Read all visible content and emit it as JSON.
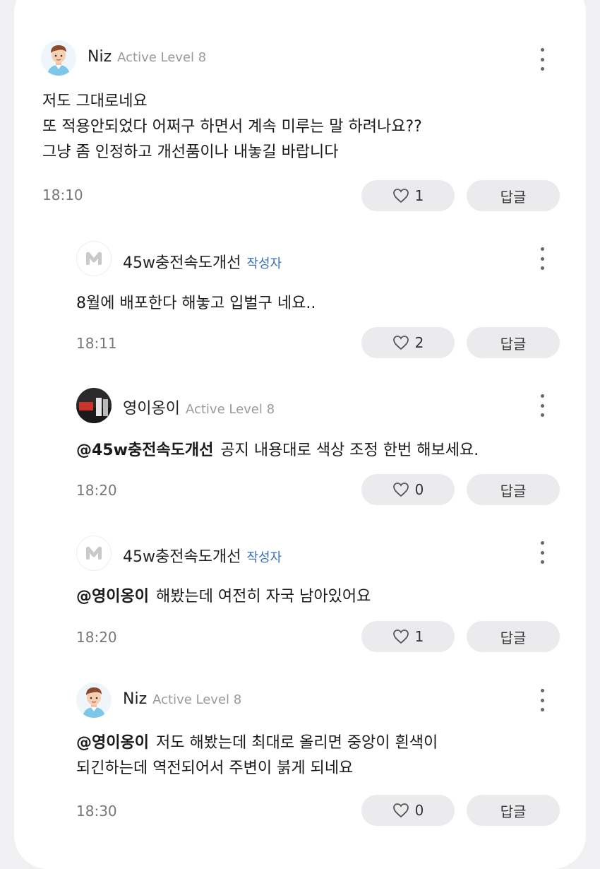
{
  "comments": [
    {
      "username": "Niz",
      "level": "Active Level 8",
      "author_tag": "",
      "mention": "",
      "lines": [
        "저도 그대로네요",
        "또 적용안되었다 어쩌구 하면서 계속 미루는 말 하려나요??",
        "그냥 좀 인정하고 개선품이나 내놓길 바랍니다"
      ],
      "time": "18:10",
      "likes": "1",
      "reply_label": "답글"
    },
    {
      "username": "45w충전속도개선",
      "level": "",
      "author_tag": "작성자",
      "mention": "",
      "lines": [
        "8월에 배포한다 해놓고 입벌구 네요.."
      ],
      "time": "18:11",
      "likes": "2",
      "reply_label": "답글"
    },
    {
      "username": "영이옹이",
      "level": "Active Level 8",
      "author_tag": "",
      "mention": "@45w충전속도개선",
      "lines": [
        "공지 내용대로 색상 조정 한번 해보세요."
      ],
      "time": "18:20",
      "likes": "0",
      "reply_label": "답글"
    },
    {
      "username": "45w충전속도개선",
      "level": "",
      "author_tag": "작성자",
      "mention": "@영이옹이",
      "lines": [
        "해봤는데 여전히 자국 남아있어요"
      ],
      "time": "18:20",
      "likes": "1",
      "reply_label": "답글"
    },
    {
      "username": "Niz",
      "level": "Active Level 8",
      "author_tag": "",
      "mention": "@영이옹이",
      "lines": [
        "저도 해봤는데 최대로 올리면 중앙이 흰색이",
        "되긴하는데 역전되어서 주변이 붉게 되네요"
      ],
      "time": "18:30",
      "likes": "0",
      "reply_label": "답글"
    }
  ],
  "icons": {
    "more": "more-vertical-icon",
    "like": "heart-outline-icon",
    "avatar_niz": "person-avatar-icon",
    "avatar_author": "m-logo-icon",
    "avatar_photo": "photo-avatar-icon"
  },
  "colors": {
    "author_tag": "#3a6fc0",
    "button_bg": "#ebebed",
    "background": "#f0f0f2"
  }
}
